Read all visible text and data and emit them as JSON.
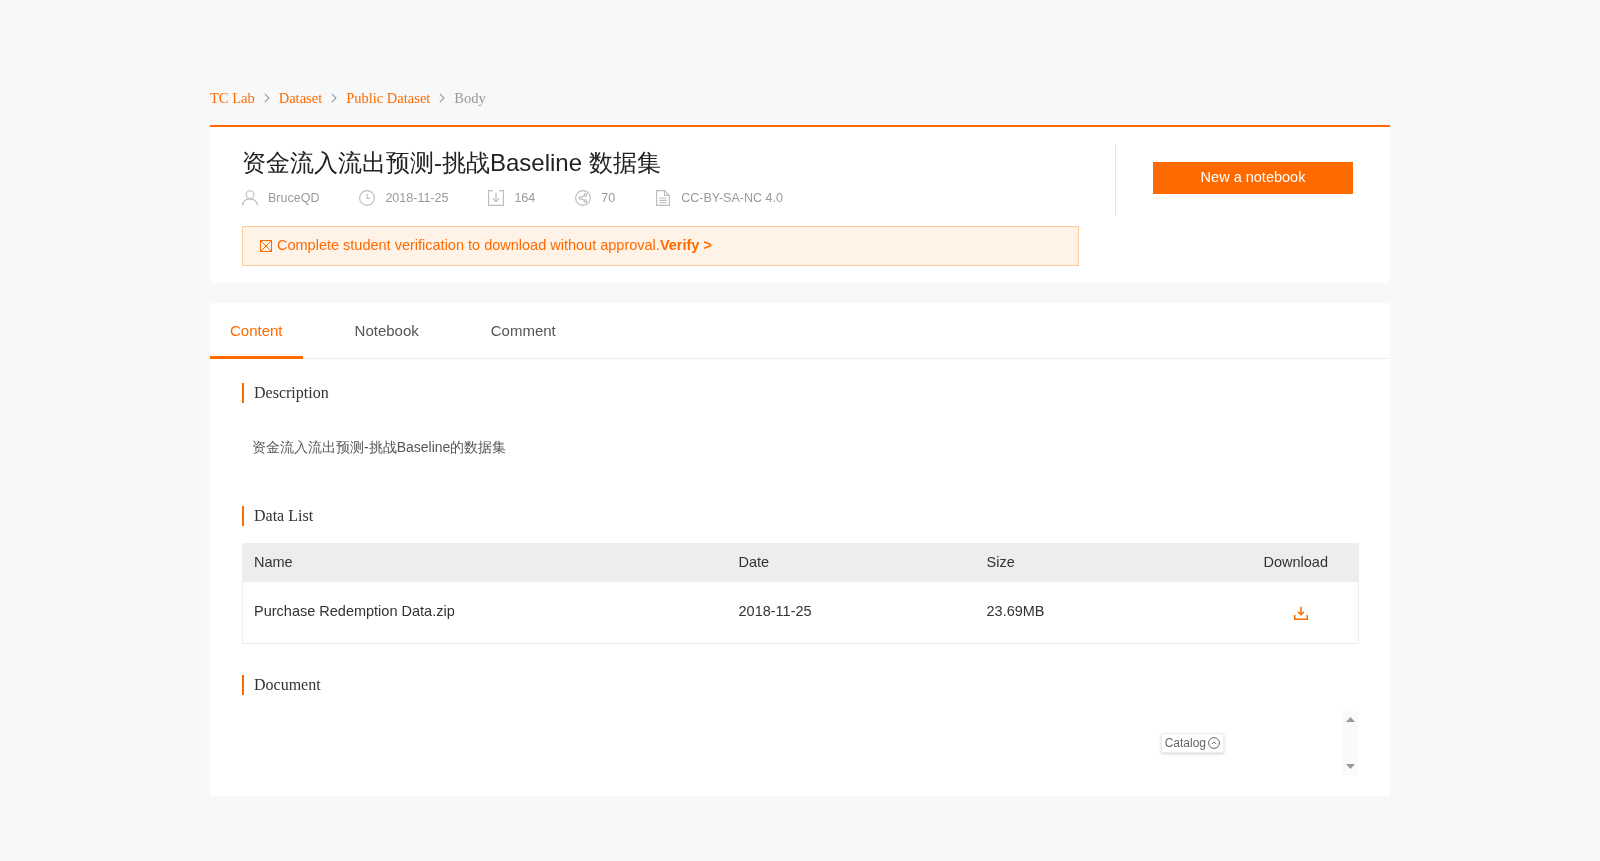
{
  "breadcrumb": [
    {
      "label": "TC Lab",
      "current": false
    },
    {
      "label": "Dataset",
      "current": false
    },
    {
      "label": "Public Dataset",
      "current": false
    },
    {
      "label": "Body",
      "current": true
    }
  ],
  "header": {
    "title": "资金流入流出预测-挑战Baseline 数据集",
    "meta": [
      {
        "kind": "author",
        "text": "BruceQD"
      },
      {
        "kind": "date",
        "text": "2018-11-25"
      },
      {
        "kind": "downloads",
        "text": "164"
      },
      {
        "kind": "shares",
        "text": "70"
      },
      {
        "kind": "license",
        "text": "CC-BY-SA-NC 4.0"
      }
    ],
    "notice": {
      "text": "Complete student verification to download without approval.",
      "link": "Verify >"
    },
    "new_notebook_button": "New a notebook"
  },
  "tabs": [
    {
      "label": "Content",
      "selected": true
    },
    {
      "label": "Notebook",
      "selected": false
    },
    {
      "label": "Comment",
      "selected": false
    }
  ],
  "description": {
    "heading": "Description",
    "text": "资金流入流出预测-挑战Baseline的数据集"
  },
  "data_list": {
    "heading": "Data List",
    "columns": [
      "Name",
      "Date",
      "Size",
      "Download"
    ],
    "rows": [
      {
        "name": "Purchase Redemption Data.zip",
        "date": "2018-11-25",
        "size": "23.69MB"
      }
    ]
  },
  "document": {
    "heading": "Document",
    "catalog_button": "Catalog"
  }
}
